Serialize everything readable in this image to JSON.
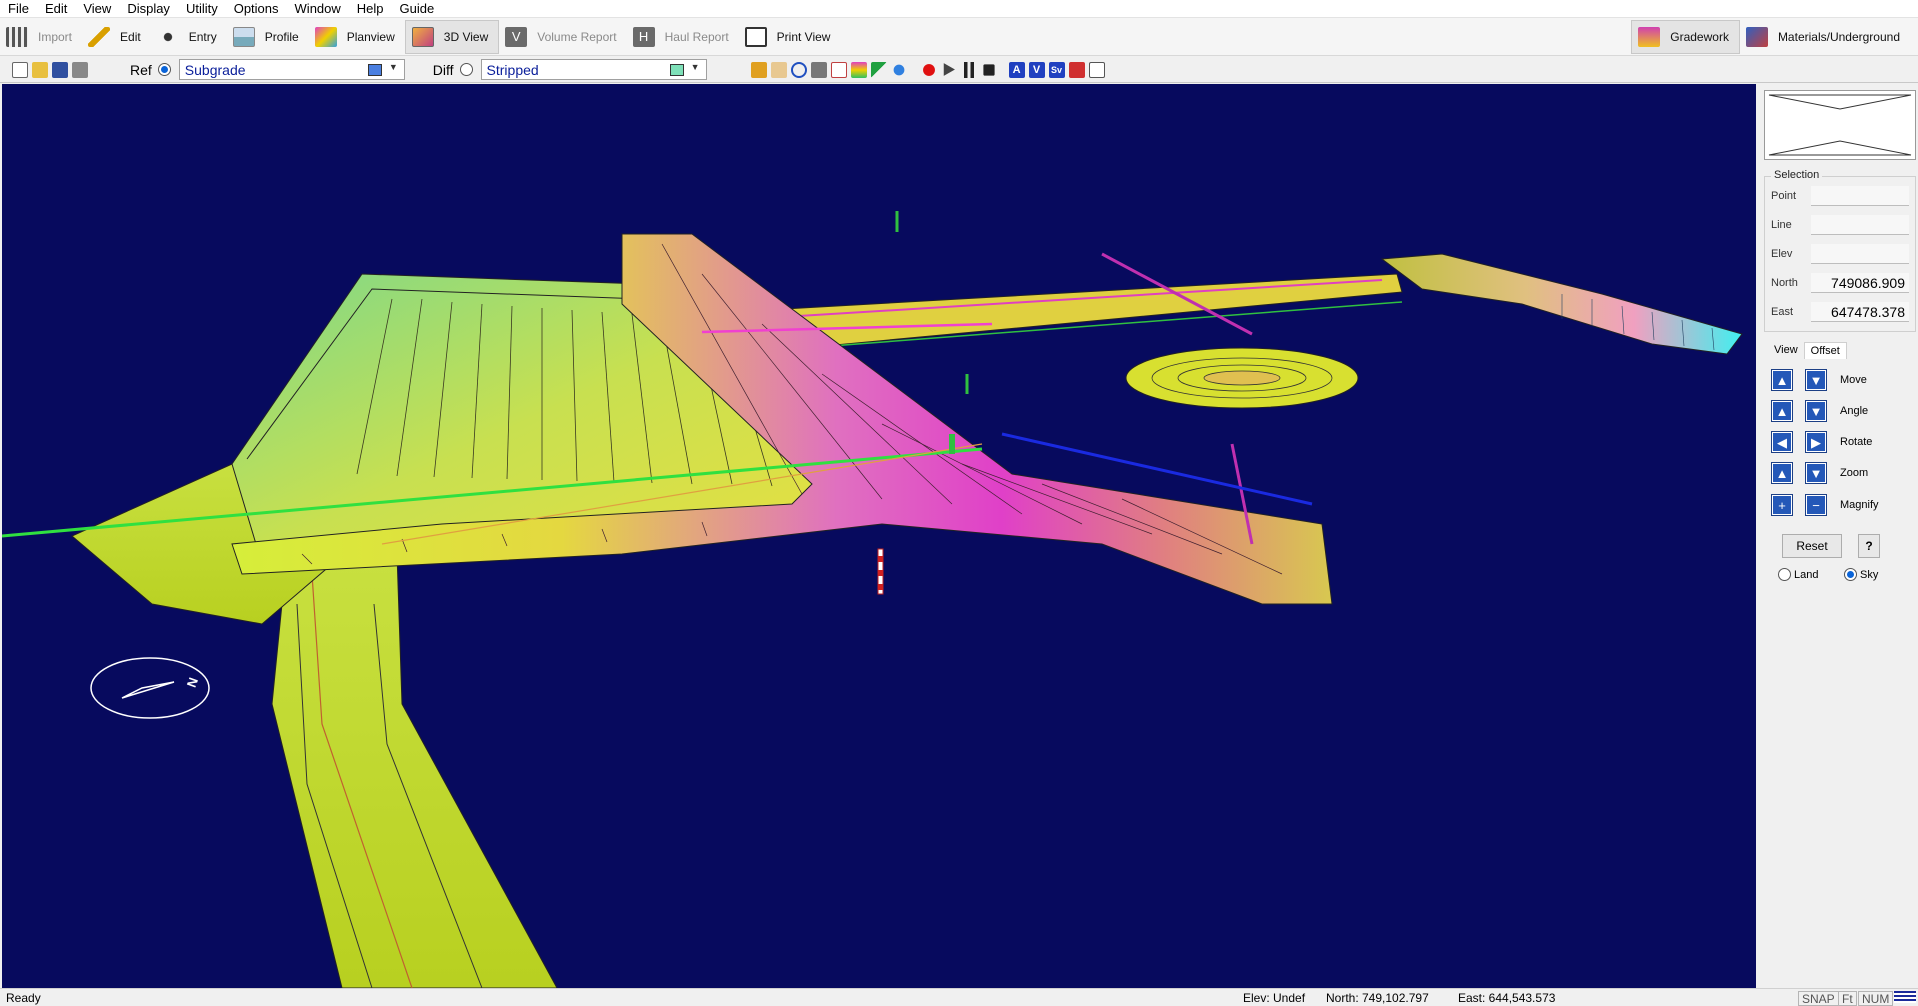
{
  "menu": [
    "File",
    "Edit",
    "View",
    "Display",
    "Utility",
    "Options",
    "Window",
    "Help",
    "Guide"
  ],
  "modes": [
    {
      "label": "Import",
      "icon": "import-icon",
      "disabled": true
    },
    {
      "label": "Edit",
      "icon": "edit-pencil-icon",
      "disabled": false
    },
    {
      "label": "Entry",
      "icon": "entry-icon",
      "disabled": false
    },
    {
      "label": "Profile",
      "icon": "profile-icon",
      "disabled": false
    },
    {
      "label": "Planview",
      "icon": "planview-icon",
      "disabled": false
    },
    {
      "label": "3D View",
      "icon": "3d-view-icon",
      "disabled": false,
      "active": true
    },
    {
      "label": "Volume Report",
      "icon": "volume-report-icon",
      "disabled": true
    },
    {
      "label": "Haul Report",
      "icon": "haul-report-icon",
      "disabled": true
    },
    {
      "label": "Print View",
      "icon": "print-view-icon",
      "disabled": false
    }
  ],
  "modules": [
    {
      "label": "Gradework",
      "icon": "gradework-icon"
    },
    {
      "label": "Materials/Underground",
      "icon": "materials-icon"
    }
  ],
  "toolbar": {
    "ref_label": "Ref",
    "ref_value": "Subgrade",
    "ref_color": "#4a7fe0",
    "diff_label": "Diff",
    "diff_value": "Stripped",
    "diff_color": "#7ee0b8"
  },
  "panel": {
    "selection_title": "Selection",
    "point_label": "Point",
    "point_value": "",
    "line_label": "Line",
    "line_value": "",
    "elev_label": "Elev",
    "elev_value": "",
    "north_label": "North",
    "north_value": "749086.909",
    "east_label": "East",
    "east_value": "647478.378",
    "tab_view": "View",
    "tab_offset": "Offset",
    "move_label": "Move",
    "angle_label": "Angle",
    "rotate_label": "Rotate",
    "zoom_label": "Zoom",
    "magnify_label": "Magnify",
    "reset_label": "Reset",
    "help_label": "?",
    "land_label": "Land",
    "sky_label": "Sky",
    "sky_selected": true
  },
  "compass": {
    "label": "N"
  },
  "status": {
    "left": "Ready",
    "elev": "Elev: Undef",
    "north": "North: 749,102.797",
    "east": "East: 644,543.573",
    "snap": "SNAP",
    "ft": "Ft",
    "num": "NUM"
  }
}
